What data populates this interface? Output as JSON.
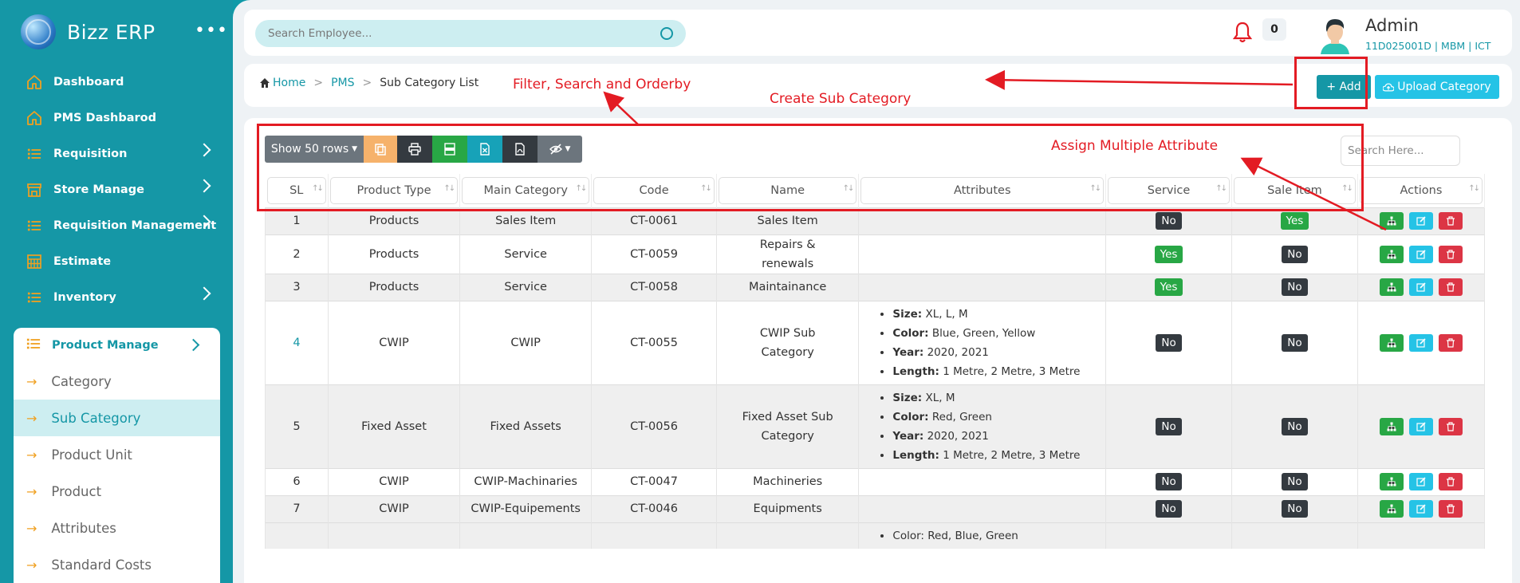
{
  "brand": {
    "name": "Bizz ERP",
    "more": "•••"
  },
  "sidebar": {
    "items": [
      {
        "label": "Dashboard",
        "icon": "home-icon",
        "has_children": false
      },
      {
        "label": "PMS Dashbarod",
        "icon": "home-icon",
        "has_children": false
      },
      {
        "label": "Requisition",
        "icon": "list-icon",
        "has_children": true
      },
      {
        "label": "Store Manage",
        "icon": "store-icon",
        "has_children": true
      },
      {
        "label": "Requisition Management",
        "icon": "list-icon",
        "has_children": true
      },
      {
        "label": "Estimate",
        "icon": "calculator-icon",
        "has_children": false
      },
      {
        "label": "Inventory",
        "icon": "list-icon",
        "has_children": true
      }
    ],
    "open_group": {
      "label": "Product Manage",
      "items": [
        {
          "label": "Category",
          "active": false
        },
        {
          "label": "Sub Category",
          "active": true
        },
        {
          "label": "Product Unit",
          "active": false
        },
        {
          "label": "Product",
          "active": false
        },
        {
          "label": "Attributes",
          "active": false
        },
        {
          "label": "Standard Costs",
          "active": false
        }
      ]
    }
  },
  "header": {
    "search_placeholder": "Search Employee...",
    "notification_count": "0",
    "user_name": "Admin",
    "user_info": "11D025001D | MBM  | ICT"
  },
  "breadcrumb": {
    "home": "Home",
    "pms": "PMS",
    "current": "Sub Category List"
  },
  "actions": {
    "add_label": "+ Add",
    "upload_label": "Upload Category"
  },
  "annotations": {
    "filter": "Filter, Search and Orderby",
    "create": "Create Sub Category",
    "assign": "Assign Multiple Attribute"
  },
  "table_toolbar": {
    "rows_label": "Show 50 rows",
    "search_placeholder": "Search Here..."
  },
  "table": {
    "columns": [
      "SL",
      "Product Type",
      "Main Category",
      "Code",
      "Name",
      "Attributes",
      "Service",
      "Sale Item",
      "Actions"
    ],
    "rows": [
      {
        "sl": "1",
        "type": "Products",
        "main": "Sales Item",
        "code": "CT-0061",
        "name": "Sales Item",
        "attrs": [],
        "service": "No",
        "sale": "Yes"
      },
      {
        "sl": "2",
        "type": "Products",
        "main": "Service",
        "code": "CT-0059",
        "name": "Repairs & renewals",
        "attrs": [],
        "service": "Yes",
        "sale": "No"
      },
      {
        "sl": "3",
        "type": "Products",
        "main": "Service",
        "code": "CT-0058",
        "name": "Maintainance",
        "attrs": [],
        "service": "Yes",
        "sale": "No"
      },
      {
        "sl": "4",
        "type": "CWIP",
        "main": "CWIP",
        "code": "CT-0055",
        "name": "CWIP Sub Category",
        "attrs": [
          {
            "k": "Size:",
            "v": "XL, L, M"
          },
          {
            "k": "Color:",
            "v": "Blue, Green, Yellow"
          },
          {
            "k": "Year:",
            "v": "2020, 2021"
          },
          {
            "k": "Length:",
            "v": "1 Metre, 2 Metre, 3 Metre"
          }
        ],
        "service": "No",
        "sale": "No"
      },
      {
        "sl": "5",
        "type": "Fixed Asset",
        "main": "Fixed Assets",
        "code": "CT-0056",
        "name": "Fixed Asset Sub Category",
        "attrs": [
          {
            "k": "Size:",
            "v": "XL, M"
          },
          {
            "k": "Color:",
            "v": "Red, Green"
          },
          {
            "k": "Year:",
            "v": "2020, 2021"
          },
          {
            "k": "Length:",
            "v": "1 Metre, 2 Metre, 3 Metre"
          }
        ],
        "service": "No",
        "sale": "No"
      },
      {
        "sl": "6",
        "type": "CWIP",
        "main": "CWIP-Machinaries",
        "code": "CT-0047",
        "name": "Machineries",
        "attrs": [],
        "service": "No",
        "sale": "No"
      },
      {
        "sl": "7",
        "type": "CWIP",
        "main": "CWIP-Equipements",
        "code": "CT-0046",
        "name": "Equipments",
        "attrs": [],
        "service": "No",
        "sale": "No"
      }
    ],
    "partial_row_attr": "Color: Red, Blue, Green"
  },
  "colors": {
    "primary": "#1597a6",
    "annotation": "#e31b23",
    "yes": "#28a745",
    "no": "#343a40"
  }
}
